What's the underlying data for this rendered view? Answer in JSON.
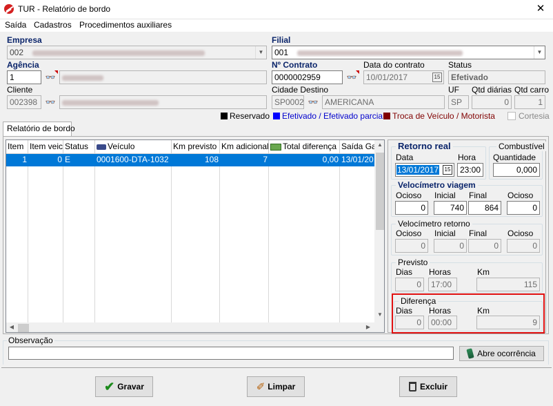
{
  "window": {
    "title": "TUR - Relatório de bordo",
    "close": "✕"
  },
  "menu": [
    "Saída",
    "Cadastros",
    "Procedimentos auxiliares"
  ],
  "form": {
    "empresa": {
      "label": "Empresa",
      "value": "002"
    },
    "filial": {
      "label": "Filial",
      "value": "001"
    },
    "agencia": {
      "label": "Agência",
      "value": "1"
    },
    "contrato": {
      "label": "Nº Contrato",
      "value": "0000002959"
    },
    "data_contrato": {
      "label": "Data do contrato",
      "value": "10/01/2017"
    },
    "status": {
      "label": "Status",
      "value": "Efetivado"
    },
    "cliente": {
      "label": "Cliente",
      "value": "002398"
    },
    "cidade_destino": {
      "label": "Cidade Destino",
      "code": "SP0002",
      "name": "AMERICANA"
    },
    "uf": {
      "label": "UF",
      "value": "SP"
    },
    "qtd_diarias": {
      "label": "Qtd diárias",
      "value": "0"
    },
    "qtd_carro": {
      "label": "Qtd carro",
      "value": "1"
    }
  },
  "legend": [
    {
      "label": "Reservado",
      "color": "#000000",
      "text_color": "#000000"
    },
    {
      "label": "Efetivado / Efetivado parcial",
      "color": "#0000ff",
      "text_color": "#0000cc"
    },
    {
      "label": "Troca de Veículo / Motorista",
      "color": "#800000",
      "text_color": "#800000"
    }
  ],
  "cortesia": "Cortesia",
  "tab": "Relatório de bordo",
  "grid": {
    "headers": [
      "Item",
      "Item veic",
      "Status",
      "Veículo",
      "Km previsto",
      "Km adicional",
      "Total diferença",
      "Saída Ga"
    ],
    "rows": [
      [
        "1",
        "0",
        "E",
        "0001600-DTA-1032",
        "108",
        "7",
        "0,00",
        "13/01/20"
      ]
    ]
  },
  "retorno_real": {
    "title": "Retorno real",
    "data_label": "Data",
    "data": "13/01/2017",
    "hora_label": "Hora",
    "hora": "23:00"
  },
  "combustivel": {
    "title": "Combustível",
    "qtd_label": "Quantidade",
    "qtd": "0,000"
  },
  "velocimetro_viagem": {
    "title": "Velocímetro viagem",
    "labels": [
      "Ocioso",
      "Inicial",
      "Final",
      "Ocioso"
    ],
    "values": [
      "0",
      "740",
      "864",
      "0"
    ]
  },
  "velocimetro_retorno": {
    "title": "Velocímetro retorno",
    "labels": [
      "Ocioso",
      "Inicial",
      "Final",
      "Ocioso"
    ],
    "values": [
      "0",
      "0",
      "0",
      "0"
    ]
  },
  "previsto": {
    "title": "Previsto",
    "labels": [
      "Dias",
      "Horas",
      "Km"
    ],
    "values": [
      "0",
      "17:00",
      "115"
    ]
  },
  "diferenca": {
    "title": "Diferença",
    "labels": [
      "Dias",
      "Horas",
      "Km"
    ],
    "values": [
      "0",
      "00:00",
      "9"
    ]
  },
  "observacao": {
    "label": "Observação",
    "value": ""
  },
  "buttons": {
    "abre": "Abre ocorrência",
    "gravar": "Gravar",
    "limpar": "Limpar",
    "excluir": "Excluir"
  }
}
